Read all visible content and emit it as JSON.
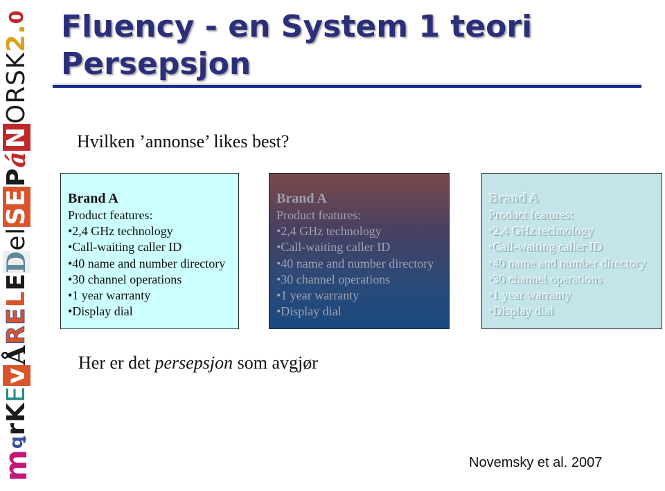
{
  "logo": {
    "segments": [
      "m",
      "ꝗ",
      "rK",
      "E",
      "v",
      "Å",
      "RE",
      "L",
      "E",
      "D",
      "el",
      "SE",
      "P",
      "á",
      "N",
      "ORSK",
      "2",
      ".",
      "0"
    ],
    "alt_text": "mirkevåreLED elSE på NORSK 2.0"
  },
  "slide": {
    "title_line1": "Fluency - en System 1 teori",
    "title_line2": "Persepsjon",
    "question": "Hvilken ’annonse’ likes best?",
    "conclusion_before": "Her er det ",
    "conclusion_em": "persepsjon",
    "conclusion_after": " som avgjør",
    "citation": "Novemsky et al. 2007"
  },
  "ads": [
    {
      "brand": "Brand A",
      "subtitle": "Product features:",
      "features": [
        "•2,4 GHz technology",
        "•Call-waiting caller ID",
        "•40 name and number directory",
        "•30 channel operations",
        "•1 year warranty",
        "•Display dial"
      ],
      "style": "high-contrast"
    },
    {
      "brand": "Brand A",
      "subtitle": "Product features:",
      "features": [
        "•2,4 GHz technology",
        "•Call-waiting caller ID",
        "•40 name and number directory",
        "•30 channel operations",
        "•1 year warranty",
        "•Display dial"
      ],
      "style": "dark-gradient"
    },
    {
      "brand": "Brand A",
      "subtitle": "Product features:",
      "features": [
        "•2,4 GHz technology",
        "•Call-waiting caller ID",
        "•40 name and number directory",
        "•30 channel operations",
        "•1 year warranty",
        "•Display dial"
      ],
      "style": "embossed-low-contrast"
    }
  ],
  "colors": {
    "title": "#2b2f7a",
    "rule": "#1a2a90",
    "ad1_bg": "#ccffff",
    "ad3_bg": "#c3e4e8"
  }
}
